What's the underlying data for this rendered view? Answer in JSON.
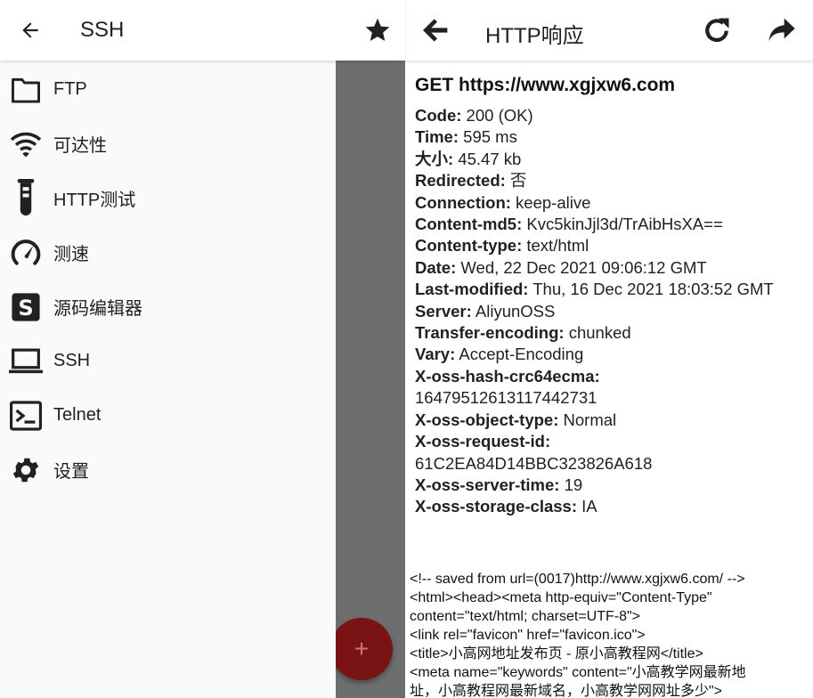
{
  "left_panel": {
    "title": "SSH",
    "back_icon": "arrow-back-icon",
    "star_icon": "star-icon",
    "menu": [
      {
        "label": "FTP",
        "icon": "folder-icon"
      },
      {
        "label": "可达性",
        "icon": "wifi-icon"
      },
      {
        "label": "HTTP测试",
        "icon": "test-tube-icon"
      },
      {
        "label": "测速",
        "icon": "speedometer-icon"
      },
      {
        "label": "源码编辑器",
        "icon": "source-editor-icon"
      },
      {
        "label": "SSH",
        "icon": "laptop-icon"
      },
      {
        "label": "Telnet",
        "icon": "terminal-icon"
      },
      {
        "label": "设置",
        "icon": "settings-gear-icon"
      }
    ],
    "fab_label": "+"
  },
  "right_panel": {
    "title": "HTTP响应",
    "request_line": "GET https://www.xgjxw6.com",
    "headers": [
      {
        "key": "Code:",
        "value": " 200 (OK)"
      },
      {
        "key": "Time:",
        "value": " 595 ms"
      },
      {
        "key": "大小:",
        "value": " 45.47 kb"
      },
      {
        "key": "Redirected:",
        "value": " 否"
      },
      {
        "key": "Connection:",
        "value": " keep-alive"
      },
      {
        "key": "Content-md5:",
        "value": " Kvc5kinJjl3d/TrAibHsXA=="
      },
      {
        "key": "Content-type:",
        "value": " text/html"
      },
      {
        "key": "Date:",
        "value": " Wed, 22 Dec 2021 09:06:12 GMT"
      },
      {
        "key": "Last-modified:",
        "value": " Thu, 16 Dec 2021 18:03:52 GMT"
      },
      {
        "key": "Server:",
        "value": " AliyunOSS"
      },
      {
        "key": "Transfer-encoding:",
        "value": " chunked"
      },
      {
        "key": "Vary:",
        "value": " Accept-Encoding"
      },
      {
        "key": "X-oss-hash-crc64ecma:",
        "value": ""
      },
      {
        "key": "",
        "value": "16479512613117442731"
      },
      {
        "key": "X-oss-object-type:",
        "value": " Normal"
      },
      {
        "key": "X-oss-request-id:",
        "value": ""
      },
      {
        "key": "",
        "value": "61C2EA84D14BBC323826A618"
      },
      {
        "key": "X-oss-server-time:",
        "value": " 19"
      },
      {
        "key": "X-oss-storage-class:",
        "value": " IA"
      }
    ],
    "body_lines": [
      "<!-- saved from url=(0017)http://www.xgjxw6.com/ -->",
      "<html><head><meta http-equiv=\"Content-Type\"",
      "content=\"text/html; charset=UTF-8\">",
      "<link rel=\"favicon\" href=\"favicon.ico\">",
      "<title>小高网地址发布页 - 原小高教程网</title>",
      "<meta name=\"keywords\" content=\"小高教学网最新地",
      "址，小高教程网最新域名，小高教学网网址多少\">"
    ]
  }
}
